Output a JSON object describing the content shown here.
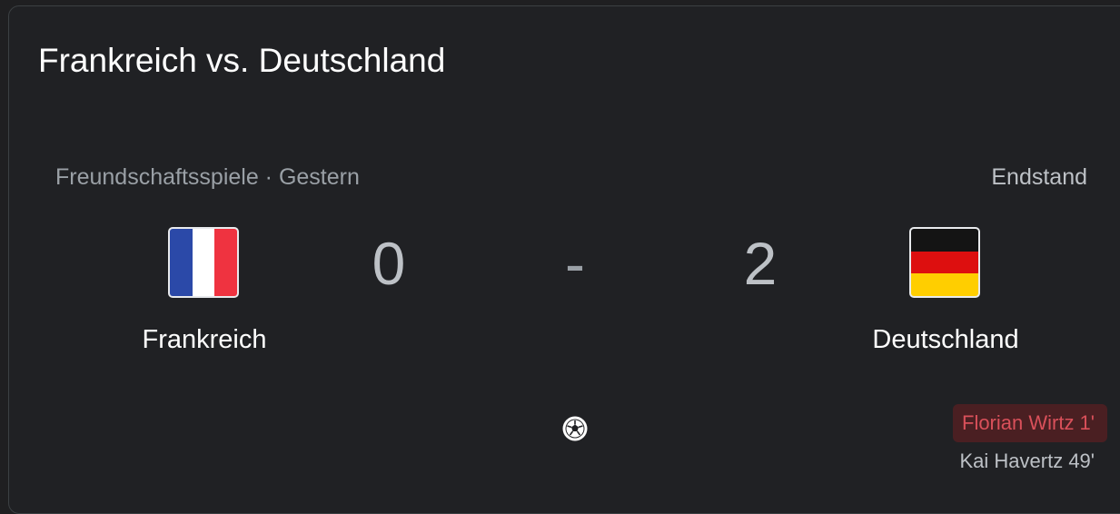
{
  "match": {
    "title": "Frankreich vs. Deutschland",
    "competition_line": "Freundschaftsspiele · Gestern",
    "status": "Endstand",
    "home": {
      "name": "Frankreich",
      "score": "0",
      "flag_colors": [
        "#2b49a8",
        "#ffffff",
        "#ef3340"
      ]
    },
    "away": {
      "name": "Deutschland",
      "score": "2",
      "flag_colors": [
        "#141414",
        "#dd0f0f",
        "#ffce00"
      ]
    },
    "separator": "-",
    "goals_icon": "soccer-ball-icon",
    "away_scorers": [
      "Florian Wirtz 1'",
      "Kai Havertz 49'"
    ]
  },
  "colors": {
    "background": "#202124",
    "highlight_bg": "#4a1f22",
    "highlight_text": "#d9505a"
  }
}
